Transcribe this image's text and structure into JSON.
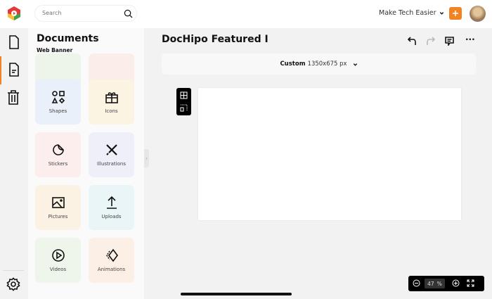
{
  "search": {
    "placeholder": "Search"
  },
  "workspace": {
    "name": "Make Tech Easier"
  },
  "panel": {
    "title": "Documents",
    "subtitle": "Web Banner",
    "tiles": [
      {
        "label": "Shapes"
      },
      {
        "label": "Icons"
      },
      {
        "label": "Stickers"
      },
      {
        "label": "Illustrations"
      },
      {
        "label": "Pictures"
      },
      {
        "label": "Uploads"
      },
      {
        "label": "Videos"
      },
      {
        "label": "Animations"
      }
    ]
  },
  "document": {
    "title": "DocHipo Featured I",
    "size_preset": "Custom",
    "size_value": "1350x675 px"
  },
  "zoom": {
    "value": "47",
    "unit": "%"
  },
  "colors": {
    "accent": "#f58220"
  }
}
